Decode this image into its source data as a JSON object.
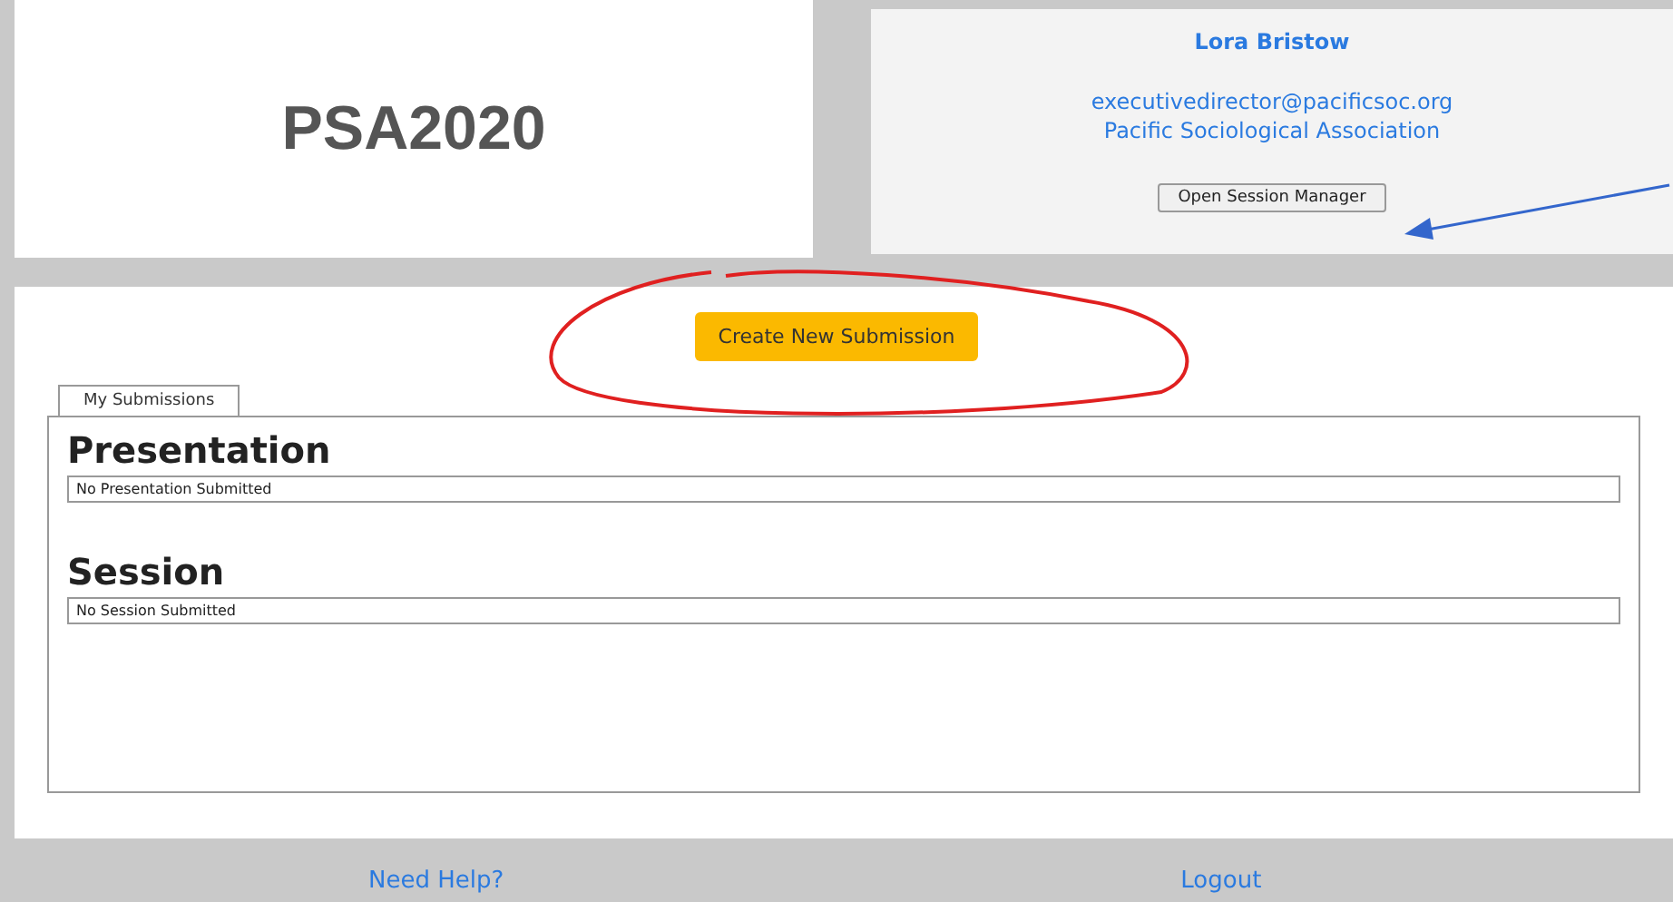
{
  "logo": "PSA2020",
  "user": {
    "name": "Lora Bristow",
    "email": "executivedirector@pacificsoc.org",
    "organization": "Pacific Sociological Association",
    "button": "Open Session Manager"
  },
  "create_button": "Create New Submission",
  "tabs": [
    {
      "label": "My Submissions",
      "selected": true
    }
  ],
  "sections": [
    {
      "title": "Presentation",
      "status": "No Presentation Submitted"
    },
    {
      "title": "Session",
      "status": "No Session Submitted"
    }
  ],
  "footer": {
    "links": [
      "Need Help?",
      "Logout"
    ]
  }
}
